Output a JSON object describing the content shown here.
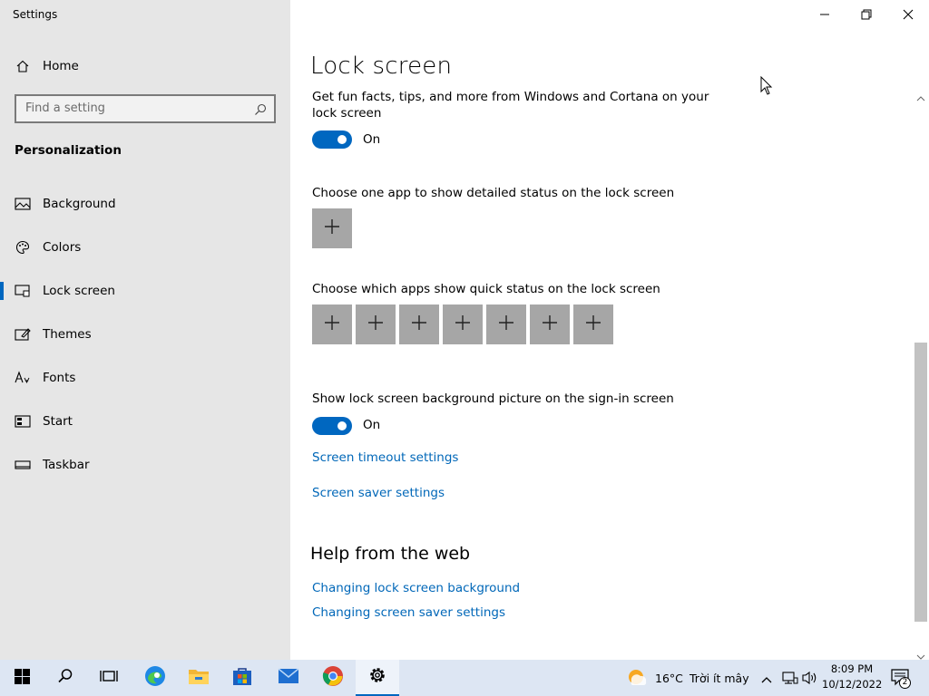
{
  "window": {
    "title": "Settings"
  },
  "sidebar": {
    "home_label": "Home",
    "search_placeholder": "Find a setting",
    "section_title": "Personalization",
    "items": [
      {
        "label": "Background",
        "icon": "picture-icon"
      },
      {
        "label": "Colors",
        "icon": "palette-icon"
      },
      {
        "label": "Lock screen",
        "icon": "lock-screen-icon",
        "active": true
      },
      {
        "label": "Themes",
        "icon": "themes-icon"
      },
      {
        "label": "Fonts",
        "icon": "fonts-icon"
      },
      {
        "label": "Start",
        "icon": "start-icon"
      },
      {
        "label": "Taskbar",
        "icon": "taskbar-icon"
      }
    ]
  },
  "main": {
    "page_title": "Lock screen",
    "fun_facts_text": "Get fun facts, tips, and more from Windows and Cortana on your lock screen",
    "fun_facts_toggle": "On",
    "detailed_status_text": "Choose one app to show detailed status on the lock screen",
    "quick_status_text": "Choose which apps show quick status on the lock screen",
    "quick_status_slots": 7,
    "signin_picture_text": "Show lock screen background picture on the sign-in screen",
    "signin_picture_toggle": "On",
    "screen_timeout_link": "Screen timeout settings",
    "screen_saver_link": "Screen saver settings",
    "help_title": "Help from the web",
    "help_links": [
      "Changing lock screen background",
      "Changing screen saver settings"
    ]
  },
  "taskbar": {
    "apps": [
      "start-icon",
      "search-icon",
      "task-view-icon",
      "edge-icon",
      "file-explorer-icon",
      "store-icon",
      "mail-icon",
      "chrome-icon",
      "settings-icon"
    ],
    "weather_temp": "16°C",
    "weather_desc": "Trời ít mây",
    "time": "8:09 PM",
    "date": "10/12/2022",
    "notification_count": "2"
  },
  "colors": {
    "accent": "#0067c0",
    "link": "#0067b8",
    "sidebar_bg": "#e6e6e6",
    "tile": "#a6a6a6"
  }
}
